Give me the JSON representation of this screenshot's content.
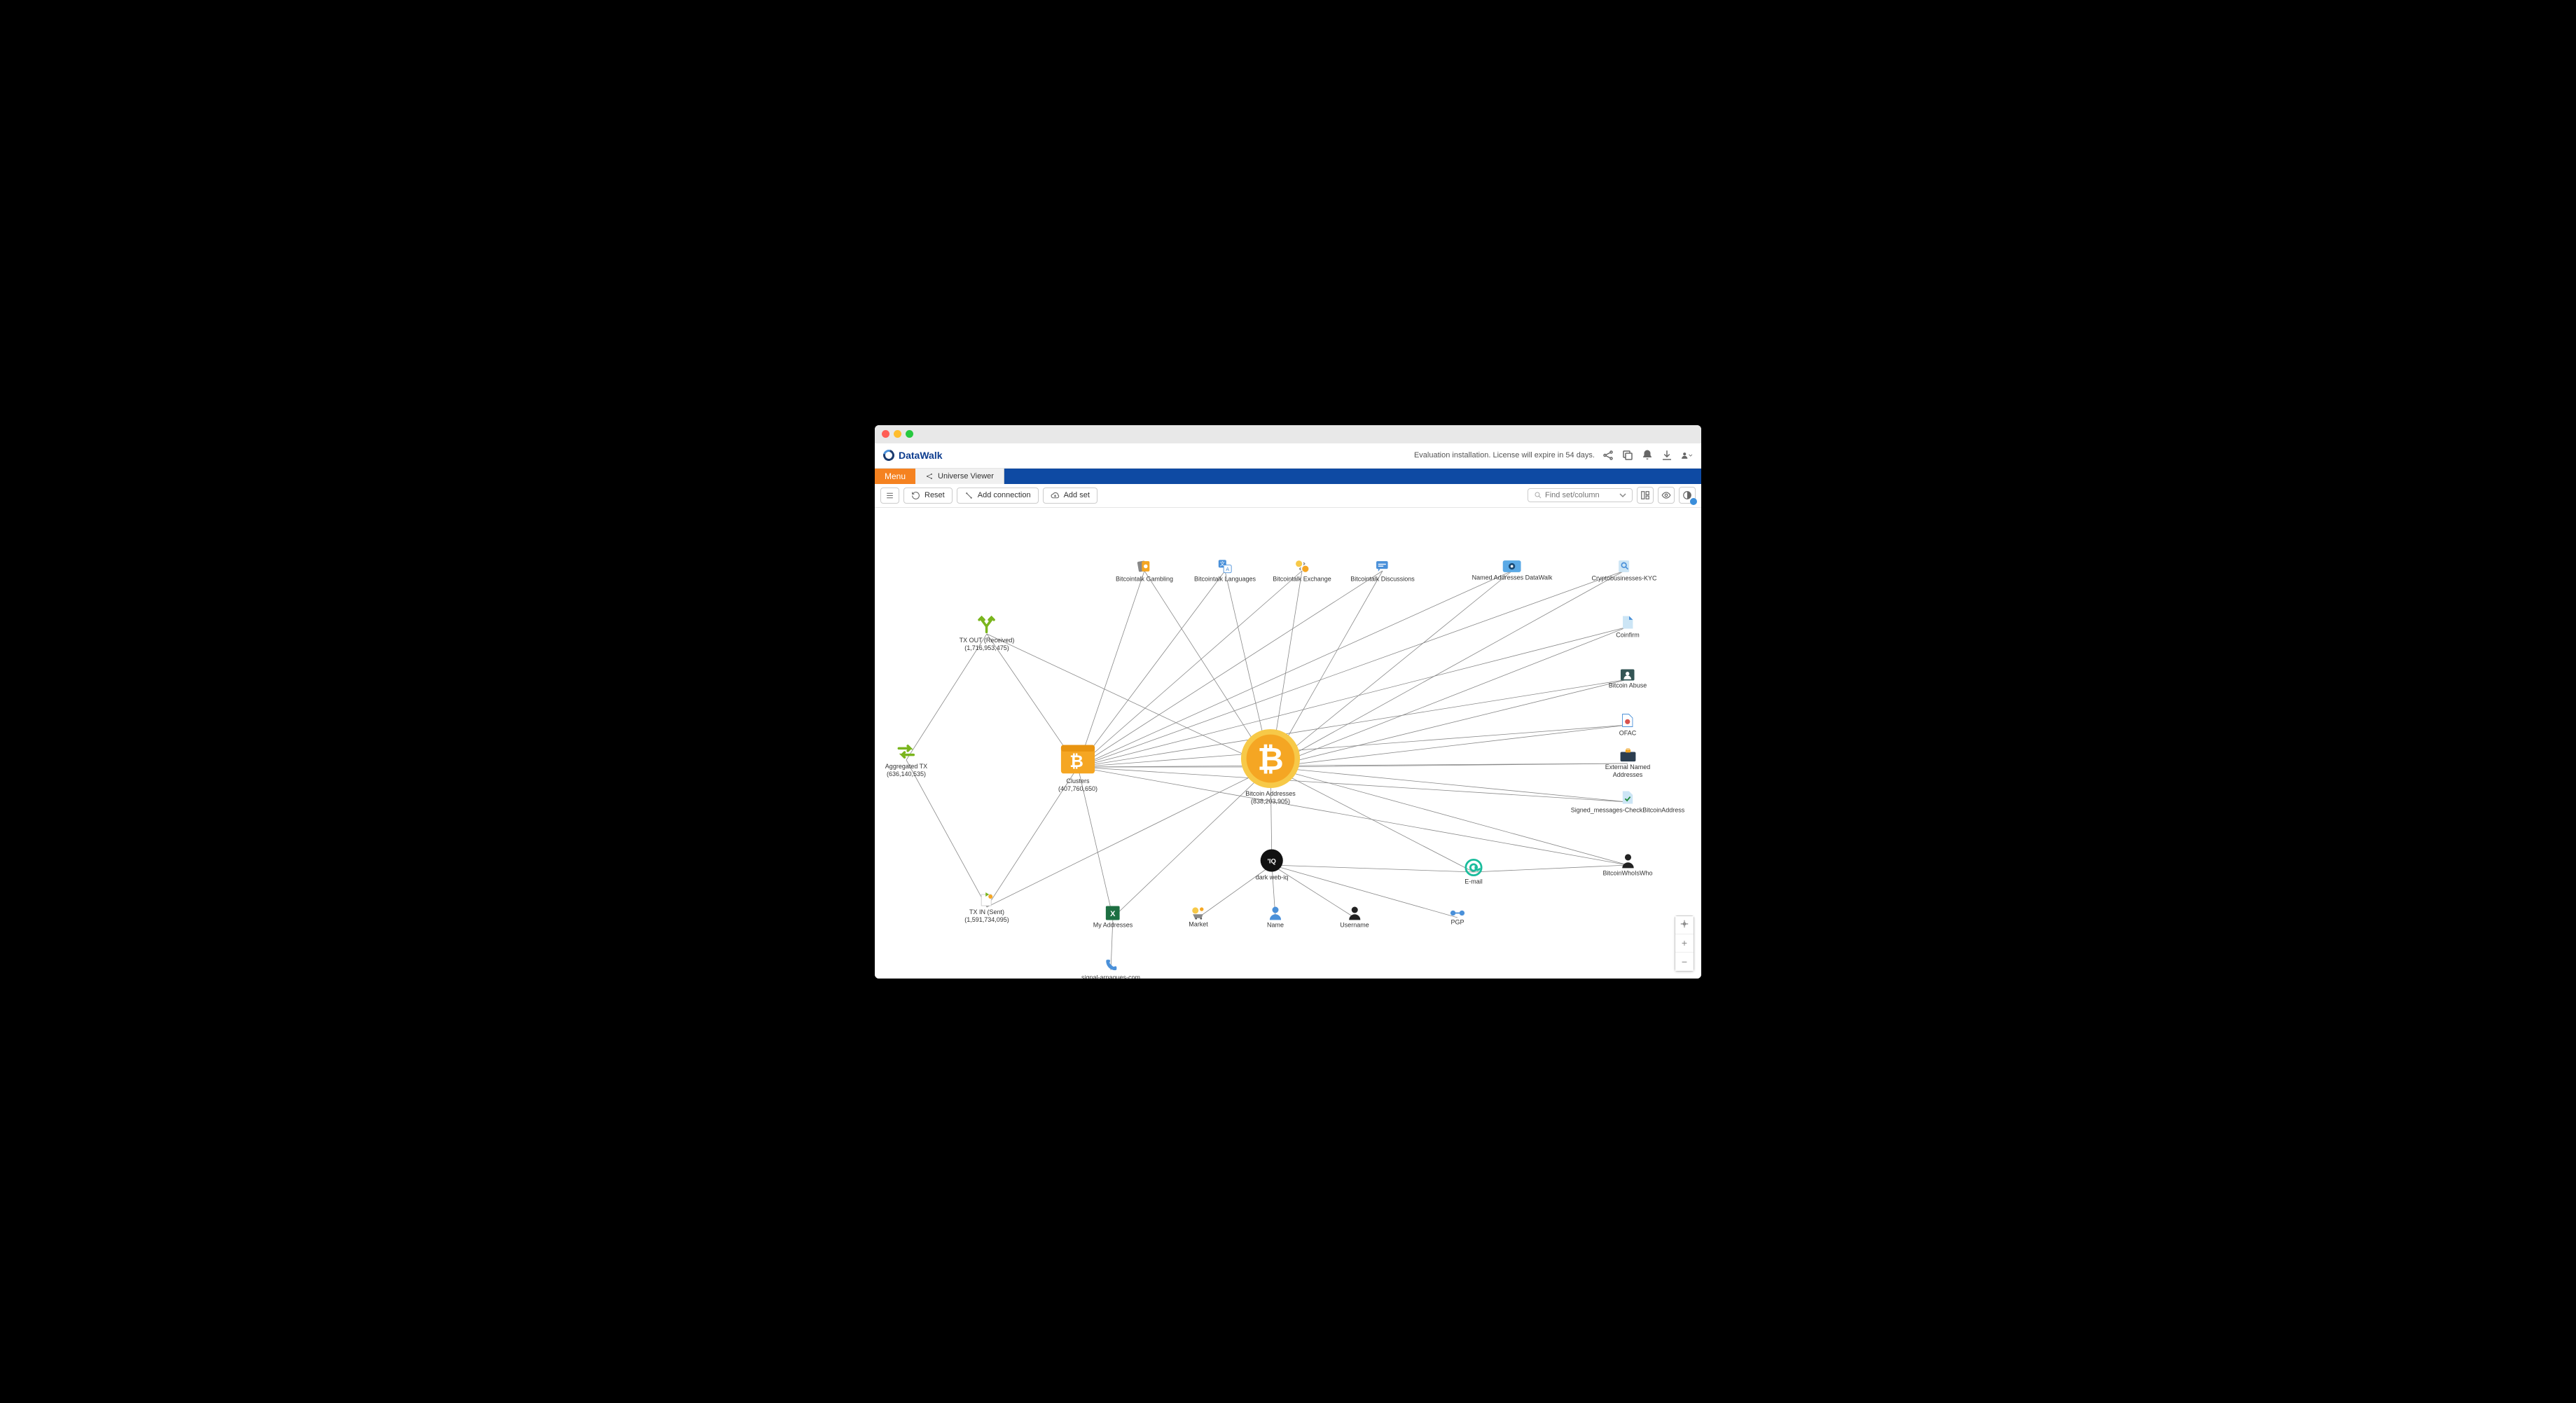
{
  "app": {
    "name": "DataWalk"
  },
  "header": {
    "notice": "Evaluation installation. License will expire in 54 days."
  },
  "menubar": {
    "menu_label": "Menu",
    "tab_label": "Universe Viewer"
  },
  "toolbar": {
    "reset_label": "Reset",
    "add_connection_label": "Add connection",
    "add_set_label": "Add set",
    "search_placeholder": "Find set/column"
  },
  "nodes": {
    "aggregated_tx": {
      "label": "Aggregated TX\n(636,140,535)"
    },
    "tx_out": {
      "label": "TX OUT (Received)\n(1,716,953,475)"
    },
    "tx_in": {
      "label": "TX IN (Sent)\n(1,591,734,095)"
    },
    "clusters": {
      "label": "Clusters\n(407,760,650)"
    },
    "bitcoin_addresses": {
      "label": "Bitcoin Addresses\n(838,203,905)"
    },
    "bitcointalk_gambling": {
      "label": "Bitcointalk Gambling"
    },
    "bitcointalk_languages": {
      "label": "Bitcointalk Languages"
    },
    "bitcointalk_exchange": {
      "label": "Bitcointalk Exchange"
    },
    "bitcointalk_discussions": {
      "label": "Bitcointalk Discussions"
    },
    "named_addresses_dw": {
      "label": "Named Addresses DataWalk"
    },
    "cryptobusinesses_kyc": {
      "label": "Cryptobusinesses-KYC"
    },
    "coinfirm": {
      "label": "Coinfirm"
    },
    "bitcoin_abuse": {
      "label": "Bitcoin Abuse"
    },
    "ofac": {
      "label": "OFAC"
    },
    "external_named": {
      "label": "External Named Addresses"
    },
    "signed_messages": {
      "label": "Signed_messages-CheckBitcoinAddress"
    },
    "bitcoin_whoiswho": {
      "label": "BitcoinWhoIsWho"
    },
    "dark_web_iq": {
      "label": "dark web-iq"
    },
    "email": {
      "label": "E-mail"
    },
    "name": {
      "label": "Name"
    },
    "username": {
      "label": "Username"
    },
    "pgp": {
      "label": "PGP"
    },
    "market": {
      "label": "Market"
    },
    "my_addresses": {
      "label": "My Addresses"
    },
    "signal_arnaques": {
      "label": "signal-arnaques-com"
    }
  }
}
